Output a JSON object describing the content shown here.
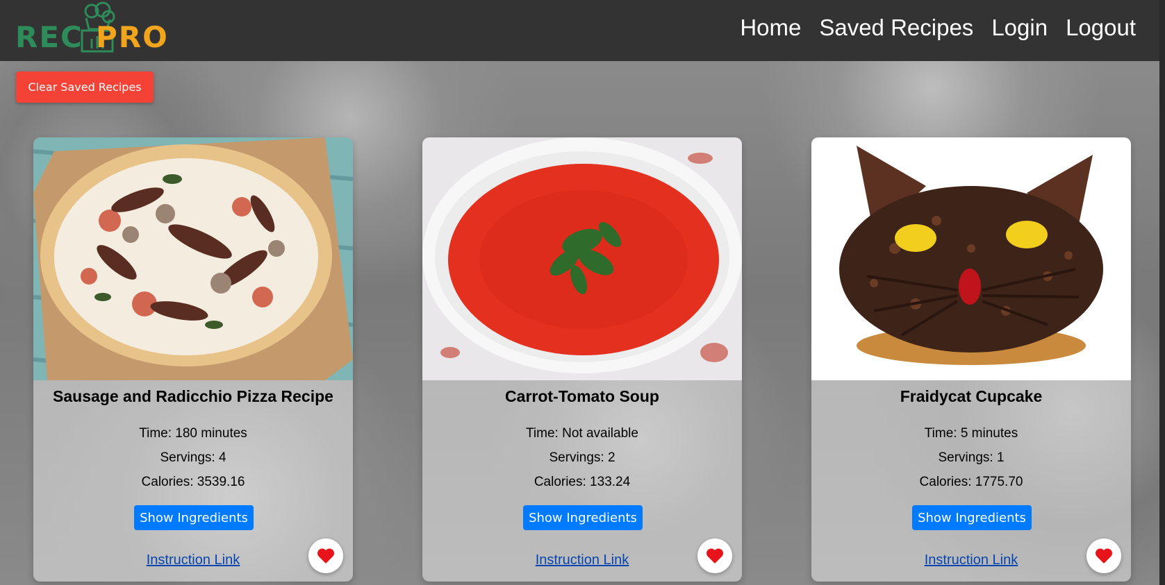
{
  "header": {
    "logo_left": "REC",
    "logo_right": "PRO",
    "nav": [
      "Home",
      "Saved Recipes",
      "Login",
      "Logout"
    ]
  },
  "actions": {
    "clear_label": "Clear Saved Recipes"
  },
  "colors": {
    "navbar": "#333333",
    "clear_button": "#f44336",
    "show_button": "#007bff",
    "heart": "#e8141c"
  },
  "recipes": [
    {
      "title": "Sausage and Radicchio Pizza Recipe",
      "time": "Time: 180 minutes",
      "servings": "Servings: 4",
      "calories": "Calories: 3539.16",
      "show_label": "Show Ingredients",
      "link_label": "Instruction Link",
      "image": "pizza"
    },
    {
      "title": "Carrot-Tomato Soup",
      "time": "Time: Not available",
      "servings": "Servings: 2",
      "calories": "Calories: 133.24",
      "show_label": "Show Ingredients",
      "link_label": "Instruction Link",
      "image": "tomato-soup"
    },
    {
      "title": "Fraidycat Cupcake",
      "time": "Time: 5 minutes",
      "servings": "Servings: 1",
      "calories": "Calories: 1775.70",
      "show_label": "Show Ingredients",
      "link_label": "Instruction Link",
      "image": "cat-cupcake"
    }
  ]
}
